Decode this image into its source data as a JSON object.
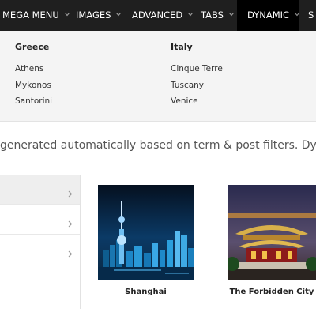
{
  "nav": {
    "items": [
      {
        "label": "MEGA MENU"
      },
      {
        "label": "IMAGES"
      },
      {
        "label": "ADVANCED"
      },
      {
        "label": "TABS"
      },
      {
        "label": "DYNAMIC"
      },
      {
        "label": "S"
      }
    ],
    "active_label": "DYNAMIC"
  },
  "mega_menu": {
    "columns": [
      {
        "heading": "Greece",
        "links": [
          "Athens",
          "Mykonos",
          "Santorini"
        ]
      },
      {
        "heading": "Italy",
        "links": [
          "Cinque Terre",
          "Tuscany",
          "Venice"
        ]
      }
    ]
  },
  "description": "generated automatically based on term & post filters. Dynamic Items",
  "tabs": {
    "count": 3,
    "active_index": 0
  },
  "cards": [
    {
      "caption": "Shanghai",
      "icon": "shanghai-skyline-photo"
    },
    {
      "caption": "The Forbidden City",
      "icon": "forbidden-city-photo"
    }
  ],
  "colors": {
    "nav_bg": "#1f1f1f",
    "nav_active_bg": "#000000",
    "panel_bg": "#f4f4f4"
  }
}
